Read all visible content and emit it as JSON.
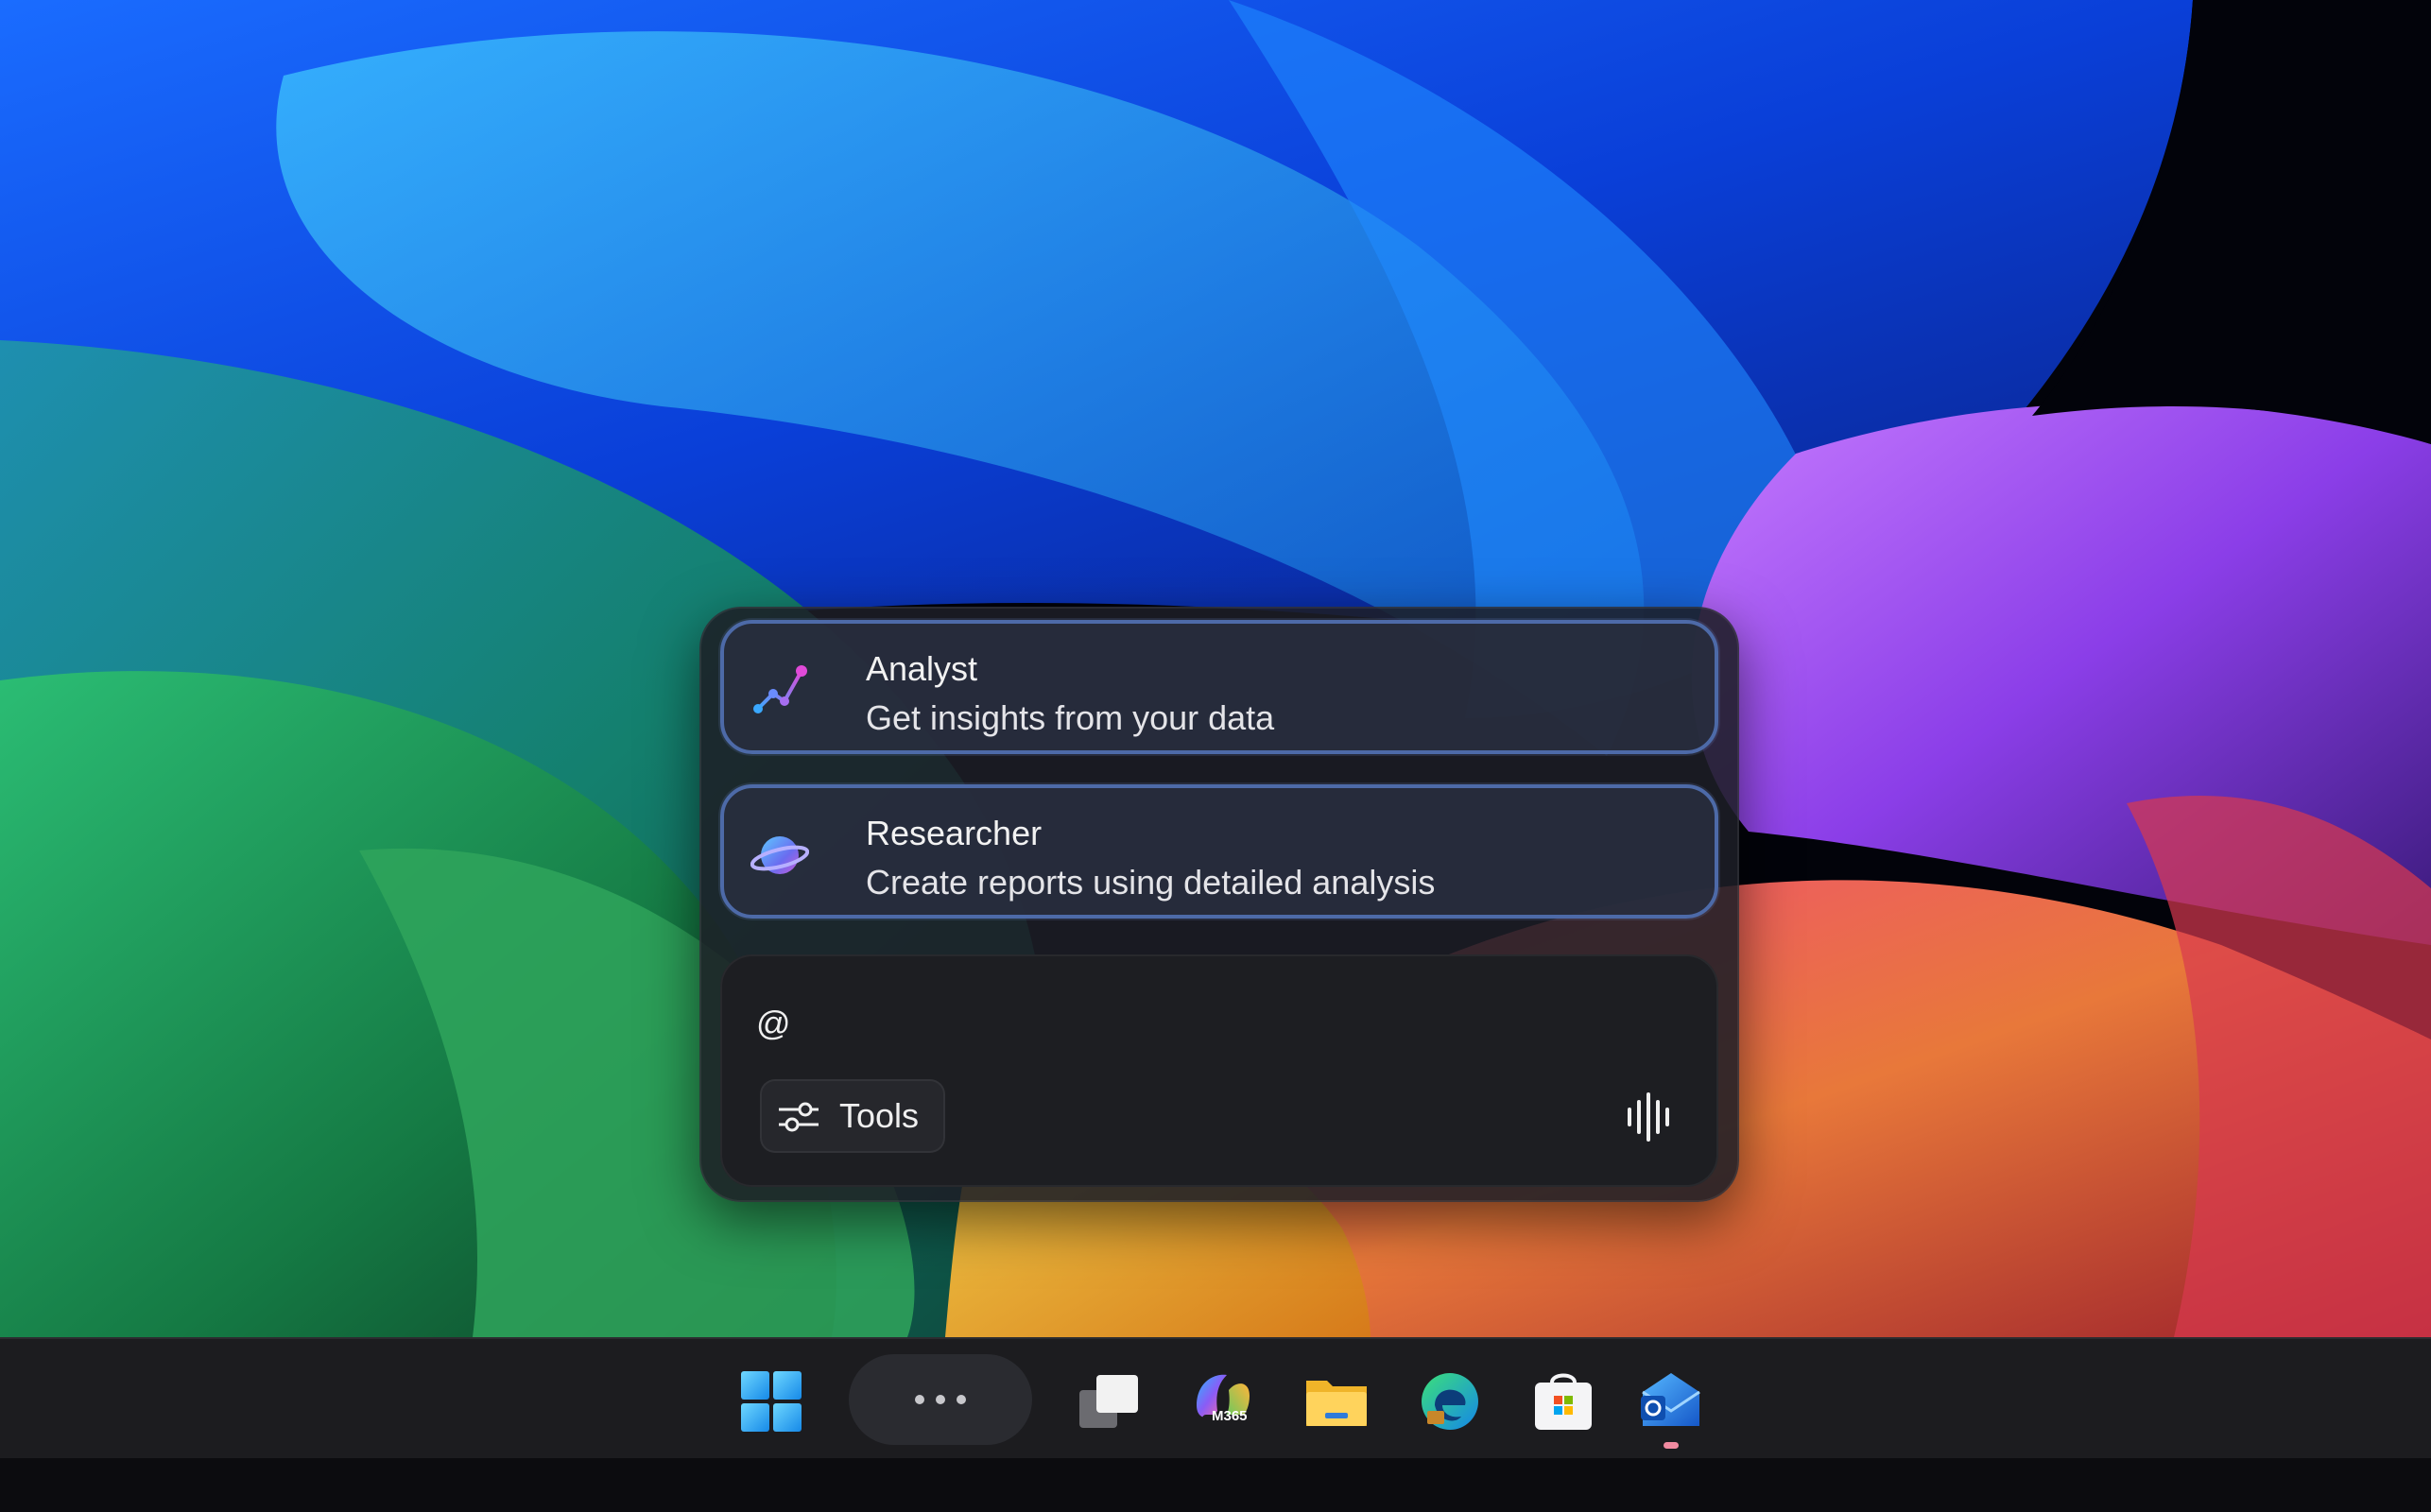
{
  "agents": [
    {
      "name": "Analyst",
      "description": "Get insights from your data",
      "icon": "analyst-chart-icon"
    },
    {
      "name": "Researcher",
      "description": "Create reports using detailed analysis",
      "icon": "researcher-planet-icon"
    }
  ],
  "composer": {
    "input_value": "@",
    "tools_label": "Tools",
    "tools_icon": "sliders-icon",
    "voice_icon": "voice-waveform-icon"
  },
  "taskbar": {
    "items": [
      {
        "name": "start",
        "icon": "windows-logo-icon"
      },
      {
        "name": "more",
        "icon": "more-dots-icon"
      },
      {
        "name": "task-view",
        "icon": "task-view-icon"
      },
      {
        "name": "microsoft-365-copilot",
        "icon": "m365-copilot-icon",
        "badge": "M365"
      },
      {
        "name": "file-explorer",
        "icon": "folder-icon"
      },
      {
        "name": "edge",
        "icon": "edge-icon"
      },
      {
        "name": "microsoft-store",
        "icon": "store-icon"
      },
      {
        "name": "outlook",
        "icon": "outlook-icon"
      }
    ]
  },
  "colors": {
    "accent_border": "#4d6aa8",
    "taskbar_bg": "#1c1c1f",
    "popup_bg": "#1c1e26"
  }
}
